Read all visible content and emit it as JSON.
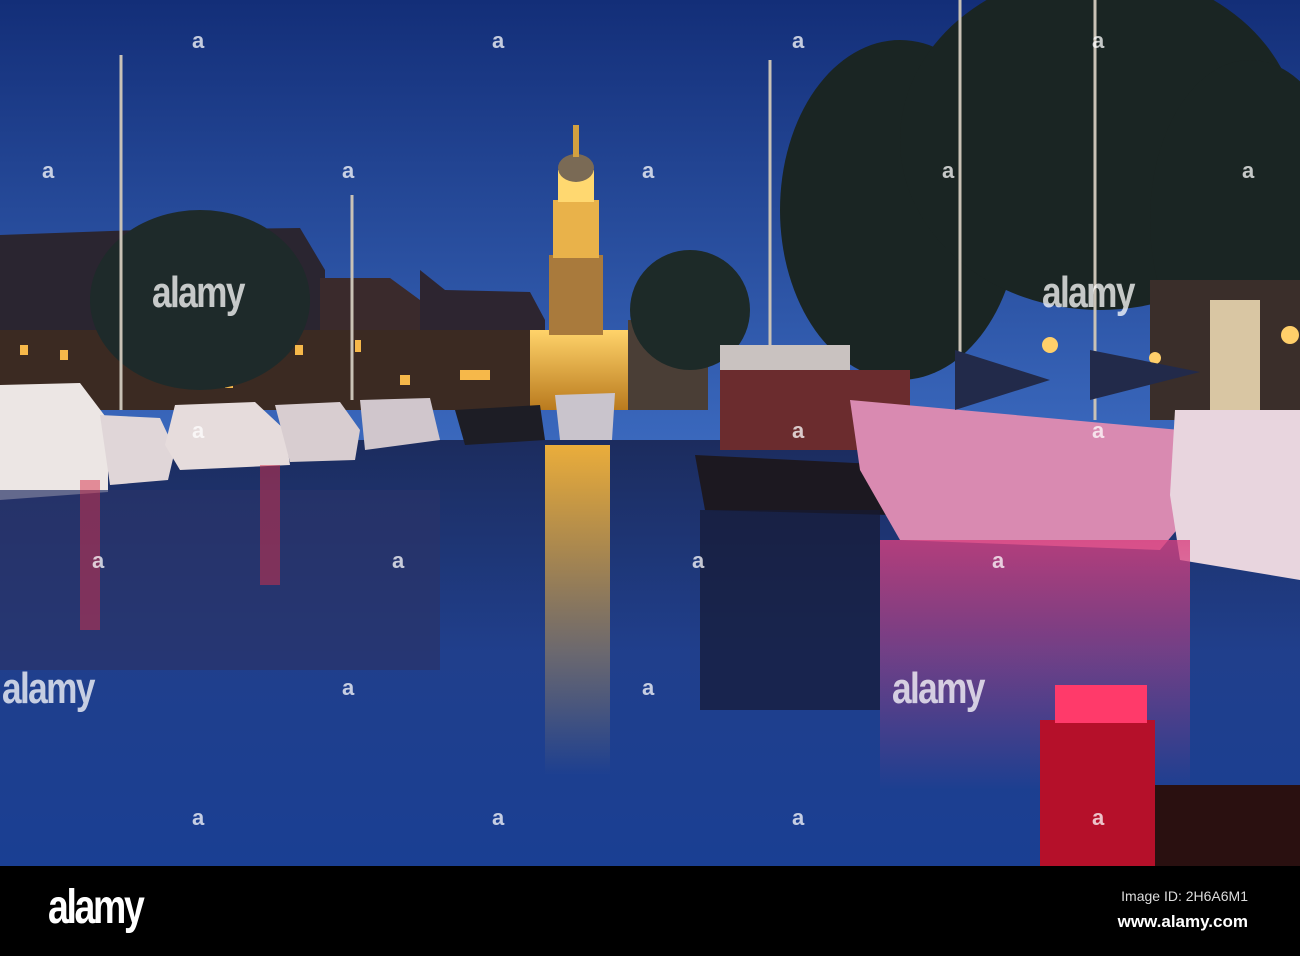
{
  "photo": {
    "subject": "Harbor at dusk with illuminated church tower and moored boats",
    "colors": {
      "sky_top": "#13307a",
      "sky_horizon": "#3563b8",
      "gold": "#f2b233",
      "pink": "#e0488a",
      "bollard": "#d8112f"
    }
  },
  "watermark": {
    "word": "alamy",
    "glyph": "a"
  },
  "footer": {
    "logo": "alamy",
    "image_id": "Image ID: 2H6A6M1",
    "website": "www.alamy.com"
  }
}
